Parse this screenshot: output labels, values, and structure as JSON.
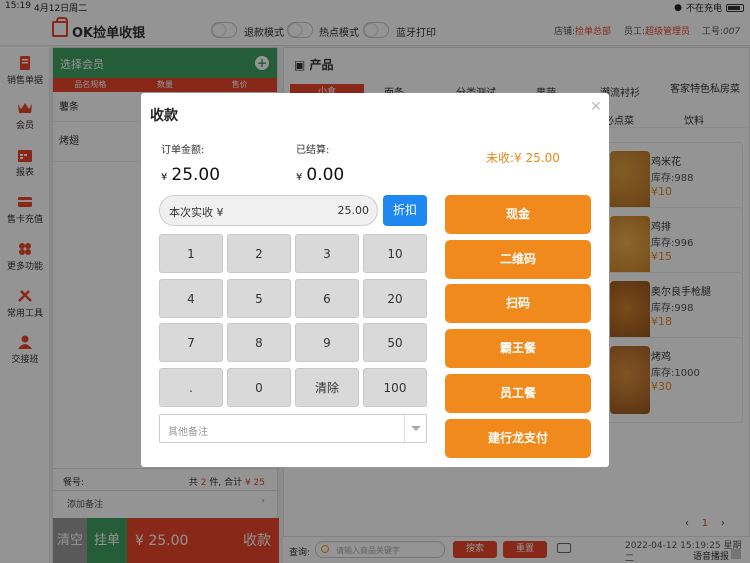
{
  "statusbar": {
    "time": "15:19",
    "date": "4月12日周二",
    "charging": "不在充电"
  },
  "header": {
    "app_title": "OK捡单收银",
    "toggles": [
      "退款模式",
      "热点模式",
      "蓝牙打印"
    ],
    "store_label": "店铺:",
    "store_value": "捡单总部",
    "staff_label": "员工:",
    "staff_value": "超级管理员",
    "id_label": "工号:",
    "id_value": "007"
  },
  "sidebar": {
    "items": [
      {
        "label": "销售单据",
        "icon": "receipt-icon"
      },
      {
        "label": "会员",
        "icon": "crown-icon"
      },
      {
        "label": "报表",
        "icon": "calendar-icon"
      },
      {
        "label": "售卡充值",
        "icon": "card-icon"
      },
      {
        "label": "更多功能",
        "icon": "grid-icon"
      },
      {
        "label": "常用工具",
        "icon": "tools-icon"
      },
      {
        "label": "交接班",
        "icon": "users-icon"
      }
    ]
  },
  "order": {
    "member_label": "选择会员",
    "columns": [
      "品名规格",
      "数量",
      "售价"
    ],
    "rows": [
      "薯条",
      "烤翅"
    ],
    "order_no_label": "餐号:",
    "summary_prefix": "共",
    "count": "2",
    "summary_mid": "件, 合计",
    "total": "¥ 25",
    "add_note": "添加备注",
    "clear_label": "清空",
    "hold_label": "挂单",
    "pay_amount": "¥ 25.00",
    "pay_label": "收款"
  },
  "products": {
    "title": "产品",
    "tabs": [
      "小食",
      "面条",
      "分类测试",
      "果蔬",
      "潮流衬衫",
      "客家特色私房菜",
      "必点菜",
      "饮料"
    ],
    "cards": [
      {
        "name": "鸡米花",
        "stock": "库存:988",
        "price": "¥10"
      },
      {
        "name": "鸡排",
        "stock": "库存:996",
        "price": "¥15"
      },
      {
        "name": "奥尔良手枪腿",
        "stock": "库存:998",
        "price": "¥18"
      },
      {
        "name": "烤鸡",
        "stock": "库存:1000",
        "price": "¥30"
      }
    ],
    "page": "1"
  },
  "query": {
    "label": "查询:",
    "placeholder": "请输入商品关键字",
    "search_label": "搜索",
    "reset_label": "重置",
    "datetime": "2022-04-12 15:19:25 星期二",
    "voice_label": "语音播报"
  },
  "modal": {
    "title": "收款",
    "order_amount_label": "订单金额:",
    "order_amount": "25.00",
    "settled_label": "已结算:",
    "settled_amount": "0.00",
    "currency": "¥",
    "unpaid_label": "未收:",
    "unpaid_amount": "¥ 25.00",
    "input_label": "本次实收 ¥",
    "input_value": "25.00",
    "discount_label": "折扣",
    "keys": [
      "1",
      "2",
      "3",
      "10",
      "4",
      "5",
      "6",
      "20",
      "7",
      "8",
      "9",
      "50",
      ".",
      "0",
      "清除",
      "100"
    ],
    "note_placeholder": "其他备注",
    "pay_methods": [
      "现金",
      "二维码",
      "扫码",
      "霸王餐",
      "员工餐",
      "建行龙支付"
    ]
  },
  "colors": {
    "accent_red": "#e8462b",
    "accent_green": "#3fa060",
    "pay_orange": "#f08a1c",
    "discount_blue": "#1e87f0",
    "unpaid_orange": "#e8881a"
  }
}
